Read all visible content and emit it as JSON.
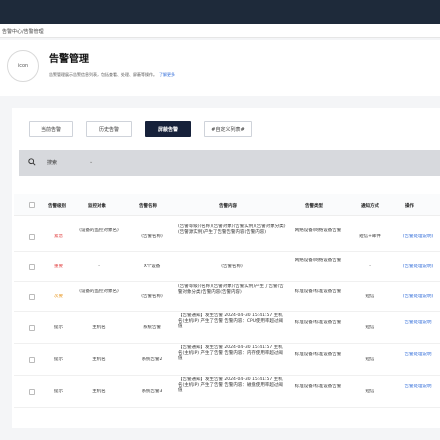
{
  "breadcrumb": "告警中心/告警管理",
  "header": {
    "avatar_text": "icon",
    "title": "告警管理",
    "description": "告警管理展示告警信息列表，包括查看、处理、屏蔽等操作。",
    "learn_more": "了解更多"
  },
  "tabs": [
    {
      "label": "当前告警",
      "active": false
    },
    {
      "label": "历史告警",
      "active": false
    },
    {
      "label": "屏蔽告警",
      "active": true
    },
    {
      "label": "#自定义列表#",
      "active": false
    }
  ],
  "search": {
    "icon": "search-icon",
    "label": "搜索",
    "dropdown_icon": "chevron-down-icon"
  },
  "table": {
    "columns": [
      "告警级别",
      "监控对象",
      "告警名称",
      "告警内容",
      "告警类型",
      "通知方式",
      "操作"
    ],
    "rows": [
      {
        "level": "紧急",
        "level_color": "#e03b3b",
        "object": "(设备的监控对象名)",
        "name": "(告警名称)",
        "content": "(告警等级)(名称)(告警对象)(告警实例)(告警对象分类)(告警源实例)产生了告警告警内容(告警内容)",
        "type": "网络设备/网络设备告警",
        "notify": "短信+邮件",
        "action": "(告警处理说明)"
      },
      {
        "level": "重要",
        "level_color": "#e03b3b",
        "object": "-",
        "name": "X个设备",
        "content": "(告警名称)",
        "type": "网络设备/网络设备告警",
        "notify": "-",
        "action": "(告警处理说明)"
      },
      {
        "level": "次要",
        "level_color": "#e8941a",
        "object": "(设备的监控对象名)",
        "name": "(告警名称)",
        "content": "(告警等级)(名称)(告警对象)(告警实例)产生了告警(告警对象分类)告警内容(告警内容)",
        "type": "标准设备/标准设备告警",
        "notify": "短信",
        "action": "(告警处理说明)"
      },
      {
        "level": "提示",
        "level_color": "#333333",
        "object": "主机名",
        "name": "系统告警",
        "content": "【告警通知】发生告警 2024-04-30 15:41:57 主机名(主机IP) 产生了告警 告警内容：CPU使用率超过阈值",
        "type": "标准设备/标准设备告警",
        "notify": "短信",
        "action": "告警处理说明"
      },
      {
        "level": "提示",
        "level_color": "#333333",
        "object": "主机名",
        "name": "系统告警2",
        "content": "【告警通知】发生告警 2024-04-30 15:41:57 主机名(主机IP) 产生了告警 告警内容：内存使用率超过阈值",
        "type": "标准设备/标准设备告警",
        "notify": "短信",
        "action": "告警处理说明"
      },
      {
        "level": "提示",
        "level_color": "#333333",
        "object": "主机名",
        "name": "系统告警3",
        "content": "【告警通知】发生告警 2024-04-30 15:41:57 主机名(主机IP) 产生了告警 告警内容：磁盘使用率超过阈值",
        "type": "标准设备/标准设备告警",
        "notify": "短信",
        "action": "告警处理说明"
      }
    ]
  },
  "colors": {
    "topbar": "#1e2a3a",
    "active_tab": "#16213a",
    "link": "#2f6bd9",
    "danger": "#e03b3b",
    "warning": "#e8941a"
  }
}
